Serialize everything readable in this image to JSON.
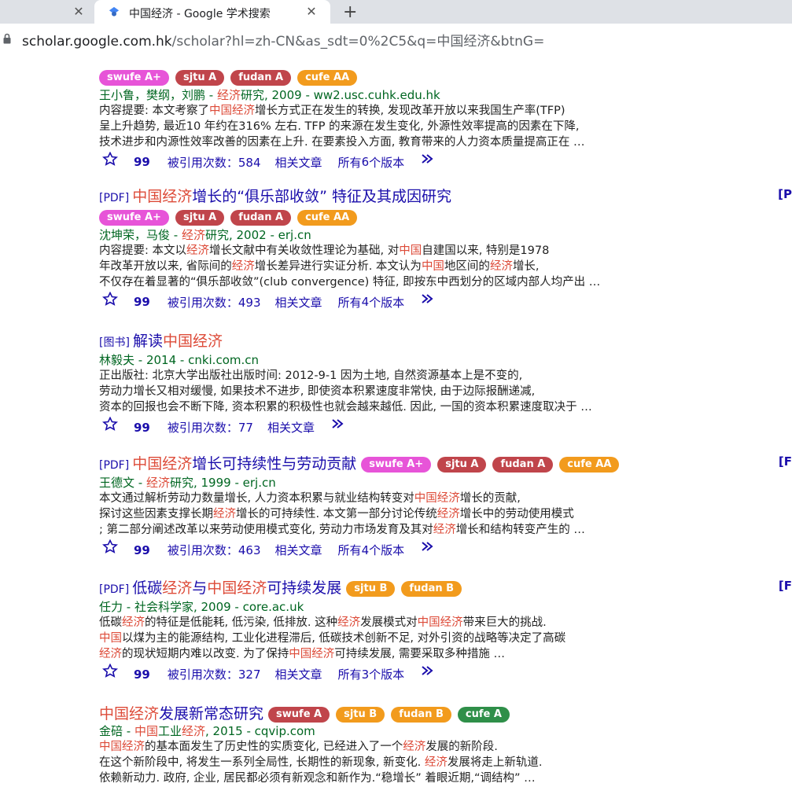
{
  "tab": {
    "title": "中国经济 - Google 学术搜索",
    "close": "✕",
    "new": "+"
  },
  "address": {
    "host": "scholar.google.com.hk",
    "path": "/scholar?hl=zh-CN&as_sdt=0%2C5&q=中国经济&btnG="
  },
  "action_labels": {
    "cited_prefix": "被引用次数",
    "related": "相关文章",
    "versions_prefix": "所有",
    "versions_suffix": "个版本"
  },
  "colors": {
    "pink": "#e754d8",
    "red": "#c0454b",
    "orange": "#f29b1d",
    "green": "#2f8f49"
  },
  "results": [
    {
      "type": "",
      "title": [],
      "badges": [
        {
          "label": "swufe A+",
          "color": "pink"
        },
        {
          "label": "sjtu A",
          "color": "red"
        },
        {
          "label": "fudan A",
          "color": "red"
        },
        {
          "label": "cufe AA",
          "color": "orange"
        }
      ],
      "authors": "王小鲁，樊纲，刘鹏 - 经济研究, 2009 - ww2.usc.cuhk.edu.hk",
      "abstract": [
        "内容提要: 本文考察了中国经济增长方式正在发生的转换, 发现改革开放以来我国生产率(TFP)",
        "呈上升趋势, 最近10 年约在316% 左右. TFP 的来源在发生变化, 外源性效率提高的因素在下降,",
        "技术进步和内源性效率改善的因素在上升. 在要素投入方面, 教育带来的人力资本质量提高正在 …"
      ],
      "cited": "584",
      "versions": "6"
    },
    {
      "type": "[PDF]",
      "title": [
        {
          "text": "中国经济",
          "hl": true
        },
        {
          "text": "增长的“俱乐部收敛” 特征及其成因研究",
          "hl": false
        }
      ],
      "badges": [
        {
          "label": "swufe A+",
          "color": "pink"
        },
        {
          "label": "sjtu A",
          "color": "red"
        },
        {
          "label": "fudan A",
          "color": "red"
        },
        {
          "label": "cufe AA",
          "color": "orange"
        }
      ],
      "authors": "沈坤荣，马俊 - 经济研究, 2002 - erj.cn",
      "abstract": [
        "内容提要: 本文以经济增长文献中有关收敛性理论为基础, 对中国自建国以来, 特别是1978",
        "年改革开放以来, 省际间的经济增长差异进行实证分析. 本文认为中国地区间的经济增长,",
        "不仅存在着显著的“俱乐部收敛”(club convergence) 特征, 即按东中西划分的区域内部人均产出 …"
      ],
      "cited": "493",
      "versions": "4",
      "right": "[P"
    },
    {
      "type": "[图书]",
      "title": [
        {
          "text": "解读",
          "hl": false
        },
        {
          "text": "中国经济",
          "hl": true
        }
      ],
      "badges": [],
      "authors": "林毅夫 - 2014 - cnki.com.cn",
      "abstract": [
        "正出版社: 北京大学出版社出版时间: 2012-9-1 因为土地, 自然资源基本上是不变的,",
        "劳动力增长又相对缓慢, 如果技术不进步, 即使资本积累速度非常快, 由于边际报酬递减,",
        "资本的回报也会不断下降, 资本积累的积极性也就会越来越低. 因此, 一国的资本积累速度取决于 …"
      ],
      "cited": "77",
      "versions": ""
    },
    {
      "type": "[PDF]",
      "title": [
        {
          "text": "中国经济",
          "hl": true
        },
        {
          "text": "增长可持续性与劳动贡献",
          "hl": false
        }
      ],
      "badges": [
        {
          "label": "swufe A+",
          "color": "pink"
        },
        {
          "label": "sjtu A",
          "color": "red"
        },
        {
          "label": "fudan A",
          "color": "red"
        },
        {
          "label": "cufe AA",
          "color": "orange"
        }
      ],
      "authors": "王德文 - 经济研究, 1999 - erj.cn",
      "abstract": [
        "本文通过解析劳动力数量增长, 人力资本积累与就业结构转变对中国经济增长的贡献,",
        "探讨这些因素支撑长期经济增长的可持续性. 本文第一部分讨论传统经济增长中的劳动使用模式",
        "; 第二部分阐述改革以来劳动使用模式变化, 劳动力市场发育及其对经济增长和结构转变产生的 …"
      ],
      "cited": "463",
      "versions": "4",
      "right": "[F"
    },
    {
      "type": "[PDF]",
      "title": [
        {
          "text": "低碳",
          "hl": false
        },
        {
          "text": "经济",
          "hl": true
        },
        {
          "text": "与",
          "hl": false
        },
        {
          "text": "中国经济",
          "hl": true
        },
        {
          "text": "可持续发展",
          "hl": false
        }
      ],
      "badges": [
        {
          "label": "sjtu B",
          "color": "orange"
        },
        {
          "label": "fudan B",
          "color": "orange"
        }
      ],
      "authors": "任力 - 社会科学家, 2009 - core.ac.uk",
      "abstract": [
        "低碳经济的特征是低能耗, 低污染, 低排放. 这种经济发展模式对中国经济带来巨大的挑战.",
        "中国以煤为主的能源结构, 工业化进程滞后, 低碳技术创新不足, 对外引资的战略等决定了高碳",
        "经济的现状短期内难以改变. 为了保持中国经济可持续发展, 需要采取多种措施 …"
      ],
      "cited": "327",
      "versions": "3",
      "right": "[F"
    },
    {
      "type": "",
      "title": [
        {
          "text": "中国经济",
          "hl": true
        },
        {
          "text": "发展新常态研究",
          "hl": false
        }
      ],
      "badges": [
        {
          "label": "swufe A",
          "color": "red"
        },
        {
          "label": "sjtu B",
          "color": "orange"
        },
        {
          "label": "fudan B",
          "color": "orange"
        },
        {
          "label": "cufe A",
          "color": "green"
        }
      ],
      "authors": "金碚 - 中国工业经济, 2015 - cqvip.com",
      "abstract": [
        "中国经济的基本面发生了历史性的实质变化, 已经进入了一个经济发展的新阶段.",
        "在这个新阶段中, 将发生一系列全局性, 长期性的新现象, 新变化. 经济发展将走上新轨道.",
        "依赖新动力. 政府, 企业, 居民都必须有新观念和新作为.“稳增长” 着眼近期,“调结构” …"
      ],
      "cited": "",
      "versions": ""
    }
  ]
}
